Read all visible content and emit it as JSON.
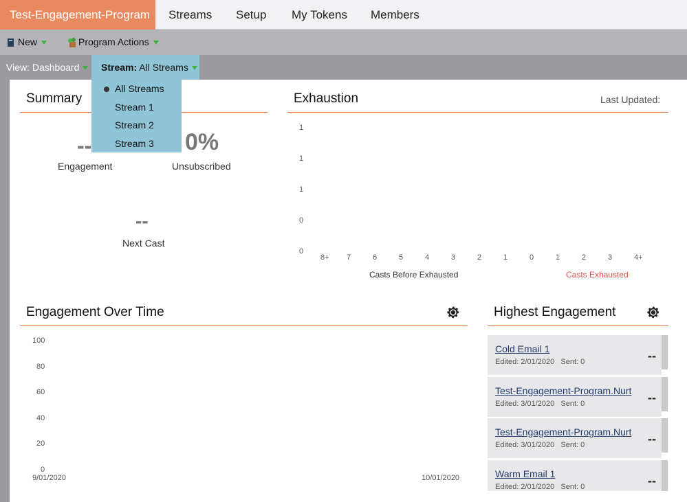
{
  "tabs": [
    {
      "label": "Test-Engagement-Program",
      "active": true
    },
    {
      "label": "Streams"
    },
    {
      "label": "Setup"
    },
    {
      "label": "My Tokens"
    },
    {
      "label": "Members"
    }
  ],
  "toolbar": {
    "new_label": "New",
    "program_actions_label": "Program Actions"
  },
  "subbar": {
    "view_label": "View: Dashboard",
    "stream_key": "Stream:",
    "stream_value": "All Streams"
  },
  "stream_dropdown": {
    "options": [
      "All Streams",
      "Stream 1",
      "Stream 2",
      "Stream 3"
    ],
    "selected": "All Streams"
  },
  "summary": {
    "title": "Summary",
    "engagement_value": "--",
    "engagement_label": "Engagement",
    "unsubscribed_value": "0%",
    "unsubscribed_label": "Unsubscribed",
    "next_cast_value": "--",
    "next_cast_label": "Next Cast"
  },
  "exhaustion": {
    "title": "Exhaustion",
    "last_updated_label": "Last Updated:",
    "chart_data": {
      "type": "bar",
      "y_ticks": [
        "1",
        "1",
        "1",
        "0",
        "0"
      ],
      "categories": [
        "8+",
        "7",
        "6",
        "5",
        "4",
        "3",
        "2",
        "1",
        "0",
        "1",
        "2",
        "3",
        "4+"
      ],
      "values": [],
      "xlabel_left": "Casts Before Exhausted",
      "xlabel_right": "Casts Exhausted",
      "colors": {
        "xlabel_right": "#d9534f"
      }
    }
  },
  "engagement_over_time": {
    "title": "Engagement Over Time",
    "chart_data": {
      "type": "line",
      "y_ticks": [
        "100",
        "80",
        "60",
        "40",
        "20",
        "0"
      ],
      "ylim": [
        0,
        100
      ],
      "x_ticks": [
        "9/01/2020",
        "10/01/2020"
      ],
      "series": []
    }
  },
  "highest_engagement": {
    "title": "Highest Engagement",
    "items": [
      {
        "title": "Cold Email 1",
        "edited": "Edited: 2/01/2020",
        "sent": "Sent: 0",
        "value": "--"
      },
      {
        "title": "Test-Engagement-Program.Nurt",
        "edited": "Edited: 3/01/2020",
        "sent": "Sent: 0",
        "value": "--"
      },
      {
        "title": "Test-Engagement-Program.Nurt",
        "edited": "Edited: 3/01/2020",
        "sent": "Sent: 0",
        "value": "--"
      },
      {
        "title": "Warm Email 1",
        "edited": "Edited: 2/01/2020",
        "sent": "Sent: 0",
        "value": "--"
      }
    ]
  },
  "colors": {
    "accent": "#e9895f",
    "rule": "#e06d3e",
    "dropdown": "#8fc5d6",
    "link": "#223a6b"
  }
}
